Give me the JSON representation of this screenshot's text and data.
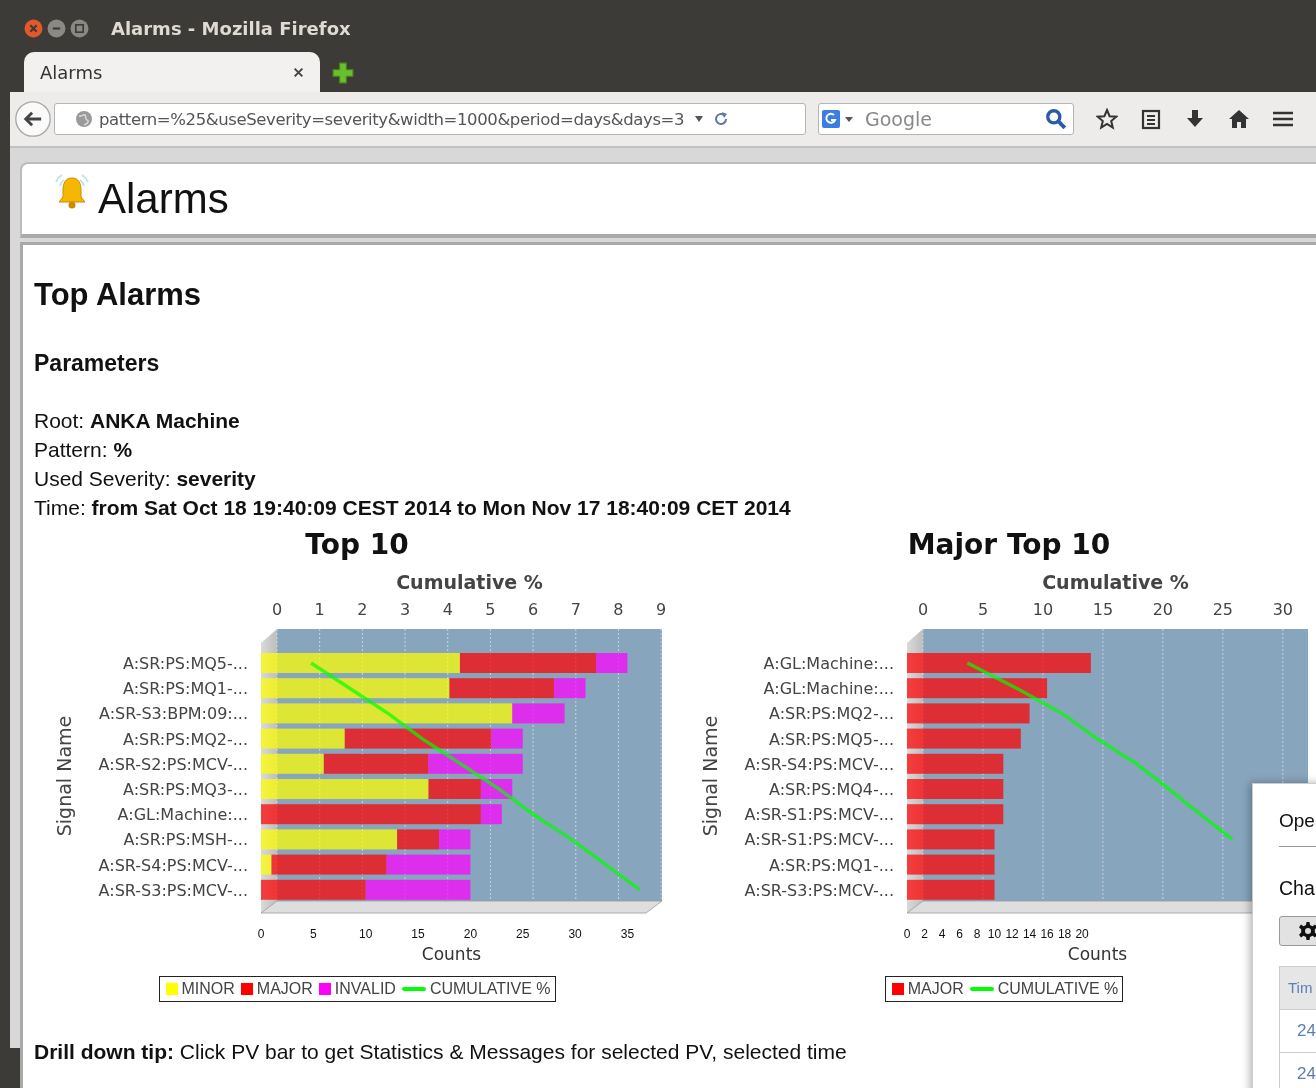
{
  "window": {
    "title": "Alarms - Mozilla Firefox"
  },
  "tabs": [
    {
      "label": "Alarms",
      "selected": true
    }
  ],
  "address_bar": {
    "url": "pattern=%25&useSeverity=severity&width=1000&period=days&days=3"
  },
  "search": {
    "placeholder": "Google"
  },
  "page": {
    "app_title": "Alarms",
    "heading": "Top Alarms",
    "parameters_heading": "Parameters",
    "parameters": [
      {
        "label": "Root:",
        "value": "ANKA Machine"
      },
      {
        "label": "Pattern:",
        "value": "%"
      },
      {
        "label": "Used Severity:",
        "value": "severity"
      },
      {
        "label": "Time:",
        "value": "from Sat Oct 18 19:40:09 CEST 2014 to Mon Nov 17 18:40:09 CET 2014"
      }
    ],
    "charts": [
      {
        "chart_data": {
          "type": "bar",
          "orientation": "horizontal",
          "stacked": true,
          "title": "Top 10",
          "xlabel": "Counts",
          "ylabel": "Signal Name",
          "categories": [
            "A:SR:PS:MQ5-...",
            "A:SR:PS:MQ1-...",
            "A:SR-S3:BPM:09:...",
            "A:SR:PS:MQ2-...",
            "A:SR-S2:PS:MCV-...",
            "A:SR:PS:MQ3-...",
            "A:GL:Machine:...",
            "A:SR:PS:MSH-...",
            "A:SR-S4:PS:MCV-...",
            "A:SR-S3:PS:MCV-..."
          ],
          "xlim": [
            0,
            38.3
          ],
          "xticks": [
            0,
            5,
            10,
            15,
            20,
            25,
            30,
            35
          ],
          "series": [
            {
              "name": "MINOR",
              "color": "#ffff00",
              "values": [
                19,
                18,
                24,
                8,
                6,
                16,
                0,
                13,
                1,
                0
              ]
            },
            {
              "name": "MAJOR",
              "color": "#ff0000",
              "values": [
                13,
                10,
                0,
                14,
                10,
                5,
                21,
                4,
                11,
                10
              ]
            },
            {
              "name": "INVALID",
              "color": "#ff00ff",
              "values": [
                3,
                3,
                5,
                3,
                9,
                3,
                2,
                3,
                8,
                10
              ]
            }
          ]
        },
        "overlay": {
          "chart_data": {
            "type": "line",
            "orientation": "horizontal",
            "xlabel": "Cumulative %",
            "xlim": [
              0,
              9.02
            ],
            "xticks": [
              0,
              1,
              2,
              3,
              4,
              5,
              6,
              7,
              8,
              9
            ],
            "series": [
              {
                "name": "CUMULATIVE %",
                "color": "#00ff00",
                "values": [
                  0.8,
                  1.7,
                  2.6,
                  3.4,
                  4.3,
                  5.2,
                  6.0,
                  6.9,
                  7.7,
                  8.5
                ]
              }
            ]
          }
        }
      },
      {
        "chart_data": {
          "type": "bar",
          "orientation": "horizontal",
          "stacked": true,
          "title": "Major Top 10",
          "xlabel": "Counts",
          "ylabel": "Signal Name",
          "categories": [
            "A:GL:Machine:...",
            "A:GL:Machine:...",
            "A:SR:PS:MQ2-...",
            "A:SR:PS:MQ5-...",
            "A:SR-S4:PS:MCV-...",
            "A:SR:PS:MQ4-...",
            "A:SR-S1:PS:MCV-...",
            "A:SR-S1:PS:MCV-...",
            "A:SR:PS:MQ1-...",
            "A:SR-S3:PS:MCV-..."
          ],
          "xlim": [
            0,
            45.8
          ],
          "xticks": [
            0,
            2,
            4,
            6,
            8,
            10,
            12,
            14,
            16,
            18,
            20
          ],
          "series": [
            {
              "name": "MAJOR",
              "color": "#ff0000",
              "values": [
                21,
                16,
                14,
                13,
                11,
                11,
                11,
                10,
                10,
                10
              ]
            }
          ]
        },
        "overlay": {
          "chart_data": {
            "type": "line",
            "orientation": "horizontal",
            "xlabel": "Cumulative %",
            "xlim": [
              0,
              32.1
            ],
            "xticks": [
              0,
              5,
              10,
              15,
              20,
              25,
              30
            ],
            "series": [
              {
                "name": "CUMULATIVE %",
                "color": "#00ff00",
                "values": [
                  3.7,
                  7.8,
                  11.6,
                  14.5,
                  17.8,
                  20.5,
                  23.1,
                  25.8,
                  null,
                  null
                ]
              }
            ]
          }
        }
      }
    ],
    "tip": "**Drill down tip:** Click PV bar to get Statistics & Messages for selected PV, selected time"
  },
  "dialog": {
    "title": "Ope",
    "subtitle": "Cha",
    "table": {
      "columns": [
        "Tim"
      ],
      "rows": [
        [
          "24"
        ],
        [
          "24"
        ]
      ]
    }
  }
}
